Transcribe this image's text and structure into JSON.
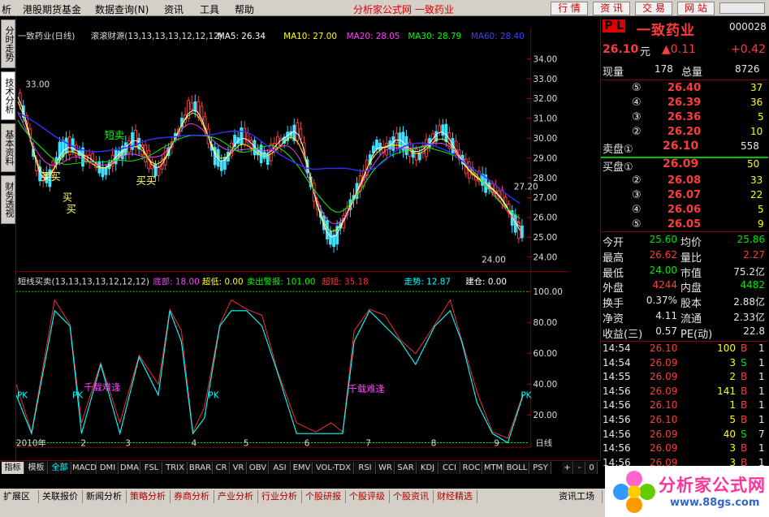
{
  "menu": {
    "items": [
      "析",
      "港股期货基金",
      "数据查询(N)",
      "资讯",
      "工具",
      "帮助"
    ],
    "title": "分析家公式网  一致药业",
    "right_buttons": [
      "行 情",
      "资 讯",
      "交 易",
      "网 站"
    ]
  },
  "side_tabs": [
    "分时走势",
    "技术分析",
    "基本资料",
    "财务透视"
  ],
  "chart": {
    "stock_label": "一致药业(日线)",
    "indicator_name": "滚滚财源(13,13,13,13,12,12,12)",
    "ma": [
      {
        "label": "MA5: 26.34",
        "color": "#ffffff"
      },
      {
        "label": "MA10: 27.00",
        "color": "#ffff00"
      },
      {
        "label": "MA20: 28.05",
        "color": "#ff40ff"
      },
      {
        "label": "MA30: 28.79",
        "color": "#00ff00"
      },
      {
        "label": "MA60: 28.40",
        "color": "#4040ff"
      }
    ],
    "y_ticks": [
      "34.00",
      "33.00",
      "32.00",
      "31.00",
      "30.00",
      "29.00",
      "28.00",
      "27.00",
      "26.00",
      "25.00",
      "24.00"
    ],
    "annotations": {
      "high_label": "33.00",
      "low_label": "24.00",
      "right_label": "27.20",
      "buy1": "买买",
      "buy2": "买",
      "buy3": "买",
      "buy4": "买买",
      "short_sell": "短卖"
    },
    "sub_indicator": {
      "name": "短线买卖(13,13,13,13,12,12,12)",
      "items": [
        {
          "label": "底部: 18.00",
          "color": "#ff40ff"
        },
        {
          "label": "超低: 0.00",
          "color": "#ffff00"
        },
        {
          "label": "卖出警报: 101.00",
          "color": "#00ff00"
        },
        {
          "label": "超短: 35.18",
          "color": "#ff3030"
        },
        {
          "label": "走势: 12.87",
          "color": "#00ffff"
        },
        {
          "label": "建仓: 0.00",
          "color": "#ffffff"
        }
      ],
      "y_ticks": [
        "100.00",
        "80.00",
        "60.00",
        "40.00",
        "20.00"
      ],
      "pk_label": "PK",
      "qz_label": "千载难逢"
    },
    "x_axis": {
      "year": "2010年",
      "months": [
        "2",
        "3",
        "4",
        "5",
        "6",
        "7",
        "8",
        "9"
      ],
      "period": "日线"
    }
  },
  "quote": {
    "brand": "P L",
    "name": "一致药业",
    "code": "000028",
    "price": "26.10",
    "price_unit": "元",
    "change": "▲0.11",
    "change_pct": "+0.42",
    "current_vol_label": "现量",
    "current_vol": "178",
    "total_vol_label": "总量",
    "total_vol": "8726",
    "asks": [
      {
        "lvl": "⑤",
        "price": "26.40",
        "vol": "37"
      },
      {
        "lvl": "④",
        "price": "26.39",
        "vol": "36"
      },
      {
        "lvl": "③",
        "price": "26.36",
        "vol": "5"
      },
      {
        "lvl": "②",
        "price": "26.20",
        "vol": "10"
      }
    ],
    "ask1_label": "卖盘①",
    "ask1_price": "26.10",
    "ask1_vol": "558",
    "bid1_label": "买盘①",
    "bid1_price": "26.09",
    "bid1_vol": "50",
    "bids": [
      {
        "lvl": "②",
        "price": "26.08",
        "vol": "33"
      },
      {
        "lvl": "③",
        "price": "26.07",
        "vol": "22"
      },
      {
        "lvl": "④",
        "price": "26.06",
        "vol": "5"
      },
      {
        "lvl": "⑤",
        "price": "26.05",
        "vol": "9"
      }
    ],
    "stats": [
      {
        "l1": "今开",
        "v1": "25.60",
        "c1": "grn",
        "l2": "均价",
        "v2": "25.86",
        "c2": "grn"
      },
      {
        "l1": "最高",
        "v1": "26.62",
        "c1": "red",
        "l2": "量比",
        "v2": "2.27",
        "c2": "red"
      },
      {
        "l1": "最低",
        "v1": "24.00",
        "c1": "grn",
        "l2": "市值",
        "v2": "75.2亿",
        "c2": "wht"
      },
      {
        "l1": "外盘",
        "v1": "4244",
        "c1": "red",
        "l2": "内盘",
        "v2": "4482",
        "c2": "grn"
      },
      {
        "l1": "换手",
        "v1": "0.37%",
        "c1": "wht",
        "l2": "股本",
        "v2": "2.88亿",
        "c2": "wht"
      },
      {
        "l1": "净资",
        "v1": "4.11",
        "c1": "wht",
        "l2": "流通",
        "v2": "2.33亿",
        "c2": "wht"
      },
      {
        "l1": "收益(三)",
        "v1": "0.57",
        "c1": "wht",
        "l2": "PE(动)",
        "v2": "22.8",
        "c2": "wht"
      }
    ],
    "ticks": [
      {
        "t": "14:54",
        "p": "26.10",
        "v": "100",
        "s": "B"
      },
      {
        "t": "14:54",
        "p": "26.09",
        "v": "3",
        "s": "S"
      },
      {
        "t": "14:55",
        "p": "26.09",
        "v": "2",
        "s": "B"
      },
      {
        "t": "14:56",
        "p": "26.09",
        "v": "141",
        "s": "B"
      },
      {
        "t": "14:56",
        "p": "26.10",
        "v": "1",
        "s": "B"
      },
      {
        "t": "14:56",
        "p": "26.10",
        "v": "5",
        "s": "B"
      },
      {
        "t": "14:56",
        "p": "26.09",
        "v": "40",
        "s": "S"
      },
      {
        "t": "14:56",
        "p": "26.09",
        "v": "3",
        "s": "B"
      },
      {
        "t": "14:56",
        "p": "26.09",
        "v": "3",
        "s": "B"
      }
    ]
  },
  "tabs": [
    "指标",
    "模板",
    "全部",
    "MACD",
    "DMI",
    "DMA",
    "FSL",
    "TRIX",
    "BRAR",
    "CR",
    "VR",
    "OBV",
    "ASI",
    "EMV",
    "VOL-TDX",
    "RSI",
    "WR",
    "SAR",
    "KDJ",
    "CCI",
    "ROC",
    "MTM",
    "BOLL",
    "PSY"
  ],
  "tab_controls": [
    "+",
    "-",
    "0"
  ],
  "status": [
    "扩展区",
    "关联报价",
    "新闻分析",
    "策略分析",
    "券商分析",
    "产业分析",
    "行业分析",
    "个股研报",
    "个股评级",
    "个股资讯",
    "财经精选",
    "资讯工场"
  ],
  "watermark": {
    "name": "分析家公式网",
    "url": "www.88gs.com"
  }
}
